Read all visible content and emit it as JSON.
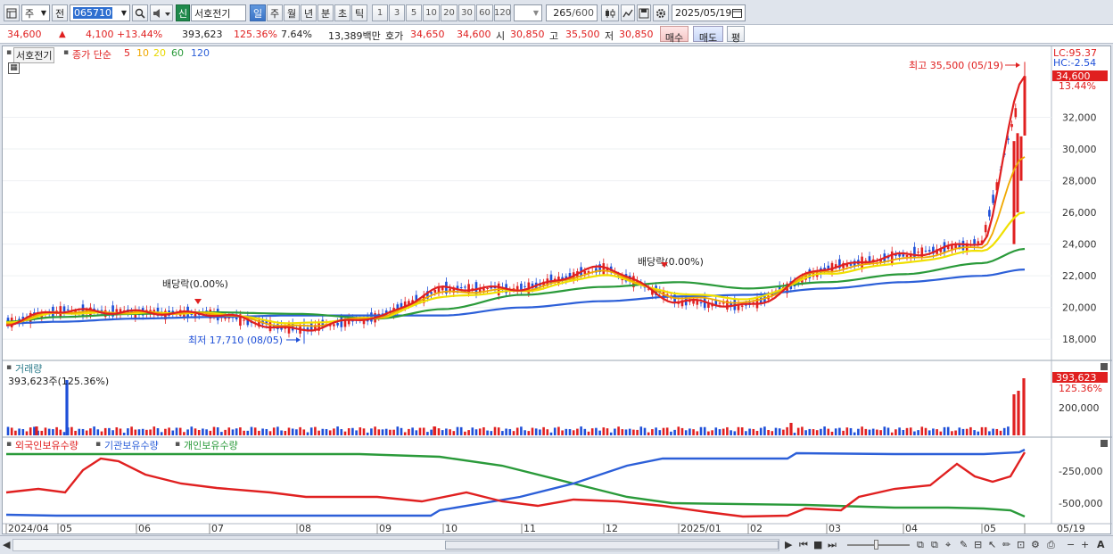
{
  "toolbar": {
    "type_label": "주",
    "prev_label": "전",
    "code": "065710",
    "credit_badge": "신",
    "stock_name": "서호전기",
    "period_tabs": [
      "일",
      "주",
      "월",
      "년",
      "분",
      "초",
      "틱"
    ],
    "active_period": "일",
    "intervals": [
      "1",
      "3",
      "5",
      "10",
      "20",
      "30",
      "60",
      "120"
    ],
    "count": "265",
    "count_max": "/600",
    "date": "2025/05/19"
  },
  "quote": {
    "price": "34,600",
    "arrow": "▲",
    "change": "4,100",
    "change_pct": "+13.44%",
    "volume": "393,623",
    "volume_ratio": "125.36%",
    "turnover": "7.64%",
    "amount": "13,389백만",
    "ask_label": "호가",
    "ask": "34,650",
    "bid": "34,600",
    "open_label": "시",
    "open": "30,850",
    "high_label": "고",
    "high": "35,500",
    "low_label": "저",
    "low": "30,850",
    "buy_label": "매수",
    "sell_label": "매도",
    "avg_label": "평"
  },
  "price_panel": {
    "stock_tag": "서호전기",
    "ma_title": "종가 단순",
    "ma_periods": [
      "5",
      "10",
      "20",
      "60",
      "120"
    ],
    "ma_colors": [
      "#e02020",
      "#f0a800",
      "#f0e000",
      "#2a9a3a",
      "#2c5fd8"
    ],
    "lc_label": "LC:95.37",
    "hc_label": "HC:-2.54",
    "price_tag": "34,600",
    "pct_tag": "13.44%",
    "y_ticks": [
      "32,000",
      "30,000",
      "28,000",
      "26,000",
      "24,000",
      "22,000",
      "20,000",
      "18,000"
    ],
    "annot_high": "최고 35,500 (05/19)",
    "annot_low": "최저 17,710 (08/05)",
    "annot_div1": "배당락(0.00%)",
    "annot_div2": "배당락(0.00%)"
  },
  "volume_panel": {
    "title": "거래량",
    "value": "393,623주(125.36%)",
    "tag": "393,623",
    "tag_pct": "125.36%",
    "y_tick": "200,000"
  },
  "holding_panel": {
    "legend": [
      "외국인보유수량",
      "기관보유수량",
      "개인보유수량"
    ],
    "legend_colors": [
      "#e02020",
      "#2c5fd8",
      "#2a9a3a"
    ],
    "y_ticks": [
      "-250,000",
      "-500,000"
    ]
  },
  "x_axis": [
    "2024/04",
    "05",
    "06",
    "07",
    "08",
    "09",
    "10",
    "11",
    "12",
    "2025/01",
    "02",
    "03",
    "04",
    "05",
    "05/19"
  ],
  "chart_data": {
    "type": "line",
    "x": [
      "2024/04",
      "2024/05",
      "2024/06",
      "2024/07",
      "2024/08",
      "2024/09",
      "2024/10",
      "2024/11",
      "2024/12",
      "2025/01",
      "2025/02",
      "2025/03",
      "2025/04",
      "2025/05",
      "2025/05/19"
    ],
    "series": [
      {
        "name": "5",
        "values": [
          19000,
          19800,
          19700,
          19600,
          18600,
          19400,
          21200,
          21200,
          22500,
          20400,
          20100,
          22500,
          23300,
          24100,
          34600
        ]
      },
      {
        "name": "60",
        "values": [
          19100,
          19400,
          19600,
          19700,
          19600,
          19300,
          19900,
          20800,
          21300,
          21600,
          21200,
          21600,
          22100,
          22800,
          23700
        ]
      },
      {
        "name": "120",
        "values": [
          19000,
          19100,
          19300,
          19400,
          19500,
          19500,
          19500,
          20000,
          20400,
          20700,
          20800,
          21200,
          21600,
          22000,
          22400
        ]
      }
    ],
    "ylim": [
      17000,
      35800
    ],
    "high": 35500,
    "low": 17710
  }
}
